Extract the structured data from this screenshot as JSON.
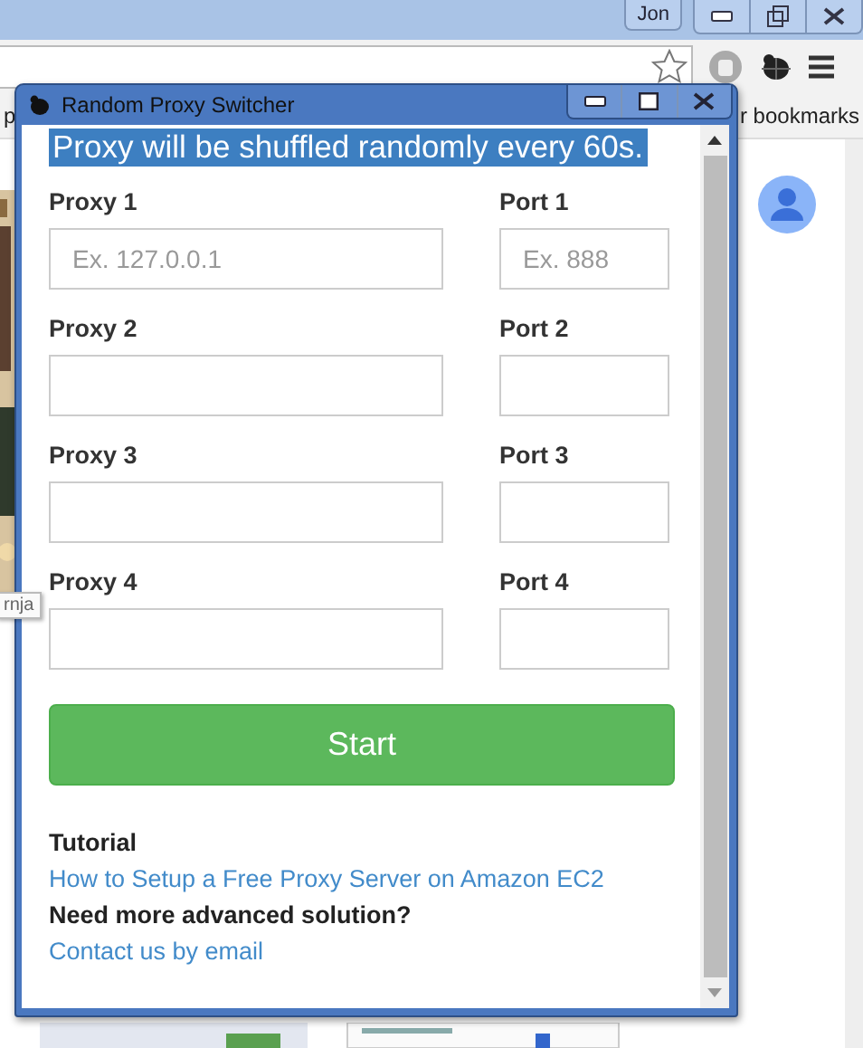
{
  "browser": {
    "profile": "Jon",
    "bookmarks_left": "p",
    "bookmarks_right": "r bookmarks",
    "tooltip": "rnja"
  },
  "popup": {
    "title": "Random Proxy Switcher",
    "banner": "Proxy will be shuffled randomly every 60s.",
    "rows": [
      {
        "proxy_label": "Proxy 1",
        "proxy_placeholder": "Ex. 127.0.0.1",
        "port_label": "Port 1",
        "port_placeholder": "Ex. 888"
      },
      {
        "proxy_label": "Proxy 2",
        "port_label": "Port 2"
      },
      {
        "proxy_label": "Proxy 3",
        "port_label": "Port 3"
      },
      {
        "proxy_label": "Proxy 4",
        "port_label": "Port 4"
      }
    ],
    "start_button": "Start",
    "tutorial_heading": "Tutorial",
    "tutorial_link": "How to Setup a Free Proxy Server on Amazon EC2",
    "advanced_heading": "Need more advanced solution?",
    "contact_link": "Contact us by email"
  }
}
